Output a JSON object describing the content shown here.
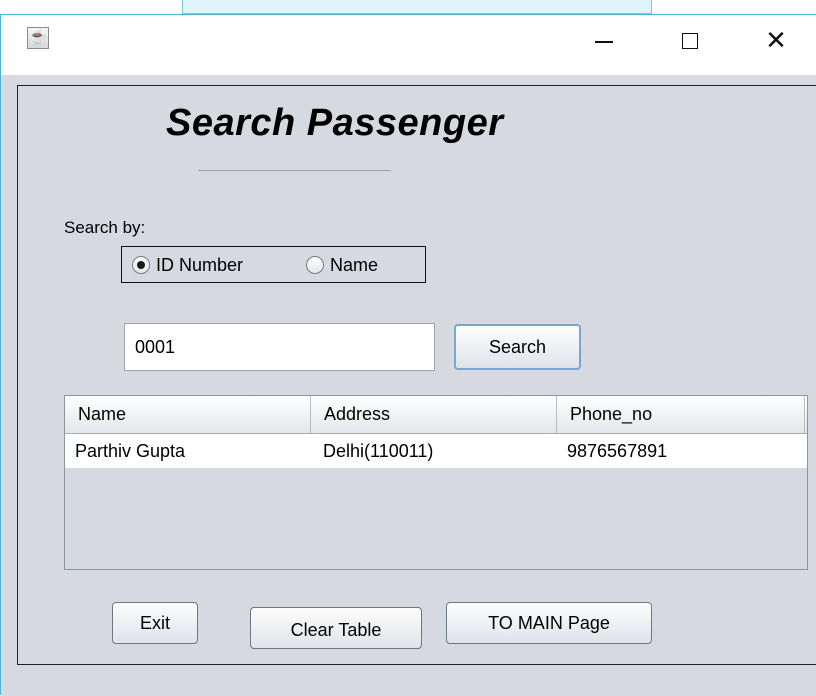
{
  "window": {
    "app_icon": "java-cup-icon",
    "minimize_symbol": "—",
    "maximize_symbol": "☐",
    "close_symbol": "✕"
  },
  "form": {
    "title": "Search Passenger",
    "search_by_label": "Search by:",
    "radio_options": [
      {
        "label": "ID Number",
        "selected": true
      },
      {
        "label": "Name",
        "selected": false
      }
    ],
    "search_value": "0001",
    "search_button": "Search"
  },
  "table": {
    "columns": [
      "Name",
      "Address",
      "Phone_no"
    ],
    "rows": [
      [
        "Parthiv Gupta",
        "Delhi(110011)",
        "9876567891"
      ]
    ]
  },
  "buttons": {
    "exit": "Exit",
    "clear_table": "Clear Table",
    "to_main": "TO MAIN Page"
  },
  "colors": {
    "panel_background": "#d6d9df",
    "window_border": "#4fb3d9",
    "search_button_focus": "#79a6cf"
  }
}
